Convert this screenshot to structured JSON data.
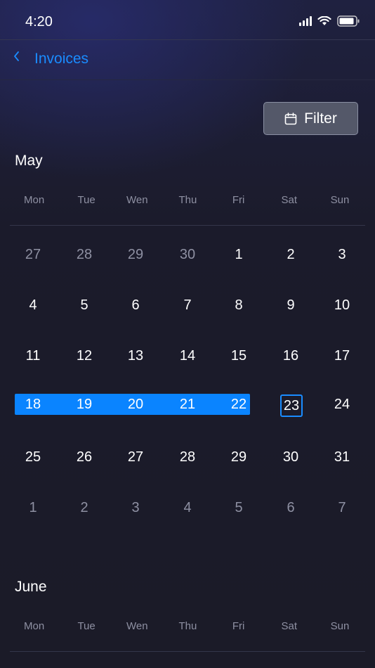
{
  "status": {
    "time": "4:20"
  },
  "nav": {
    "back_label": "Invoices"
  },
  "toolbar": {
    "filter_label": "Filter"
  },
  "months": [
    {
      "name": "May",
      "weekdays": [
        "Mon",
        "Tue",
        "Wen",
        "Thu",
        "Fri",
        "Sat",
        "Sun"
      ],
      "weeks": [
        [
          "27",
          "28",
          "29",
          "30",
          "1",
          "2",
          "3"
        ],
        [
          "4",
          "5",
          "6",
          "7",
          "8",
          "9",
          "10"
        ],
        [
          "11",
          "12",
          "13",
          "14",
          "15",
          "16",
          "17"
        ],
        [
          "18",
          "19",
          "20",
          "21",
          "22",
          "23",
          "24"
        ],
        [
          "25",
          "26",
          "27",
          "28",
          "29",
          "30",
          "31"
        ],
        [
          "1",
          "2",
          "3",
          "4",
          "5",
          "6",
          "7"
        ]
      ],
      "selected_range": [
        "18",
        "22"
      ],
      "today": "23"
    },
    {
      "name": "June",
      "weekdays": [
        "Mon",
        "Tue",
        "Wen",
        "Thu",
        "Fri",
        "Sat",
        "Sun"
      ]
    }
  ],
  "colors": {
    "accent": "#1a8cff",
    "range_fill": "#0a84ff",
    "background": "#1b1b28",
    "muted_text": "#8e90a2"
  },
  "icons": {
    "back": "chevron-left-icon",
    "filter": "calendar-icon"
  }
}
